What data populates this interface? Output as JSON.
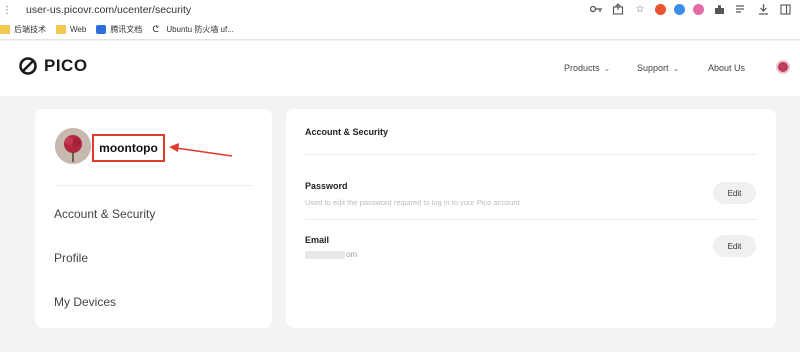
{
  "browser": {
    "url": "user-us.picovr.com/ucenter/security",
    "bookmarks": [
      {
        "label": "后端技术",
        "color": "#f2c94c"
      },
      {
        "label": "Web",
        "color": "#f2c94c"
      },
      {
        "label": "腾讯文档",
        "color": "#2f6fdd"
      },
      {
        "label": "Ubuntu 防火墙 uf...",
        "color": "#333333"
      }
    ]
  },
  "header": {
    "logo_text": "PICO",
    "nav": {
      "products": "Products",
      "support": "Support",
      "about": "About Us"
    }
  },
  "sidebar": {
    "username": "moontopo",
    "items": [
      {
        "label": "Account & Security"
      },
      {
        "label": "Profile"
      },
      {
        "label": "My Devices"
      }
    ]
  },
  "main": {
    "title": "Account & Security",
    "password": {
      "label": "Password",
      "description": "Used to edit the password required to log in to your Pico account",
      "button": "Edit"
    },
    "email": {
      "label": "Email",
      "value_suffix": "om",
      "button": "Edit"
    }
  },
  "colors": {
    "accent_red": "#e03a2f",
    "page_bg": "#f3f3f3",
    "card_bg": "#ffffff"
  }
}
